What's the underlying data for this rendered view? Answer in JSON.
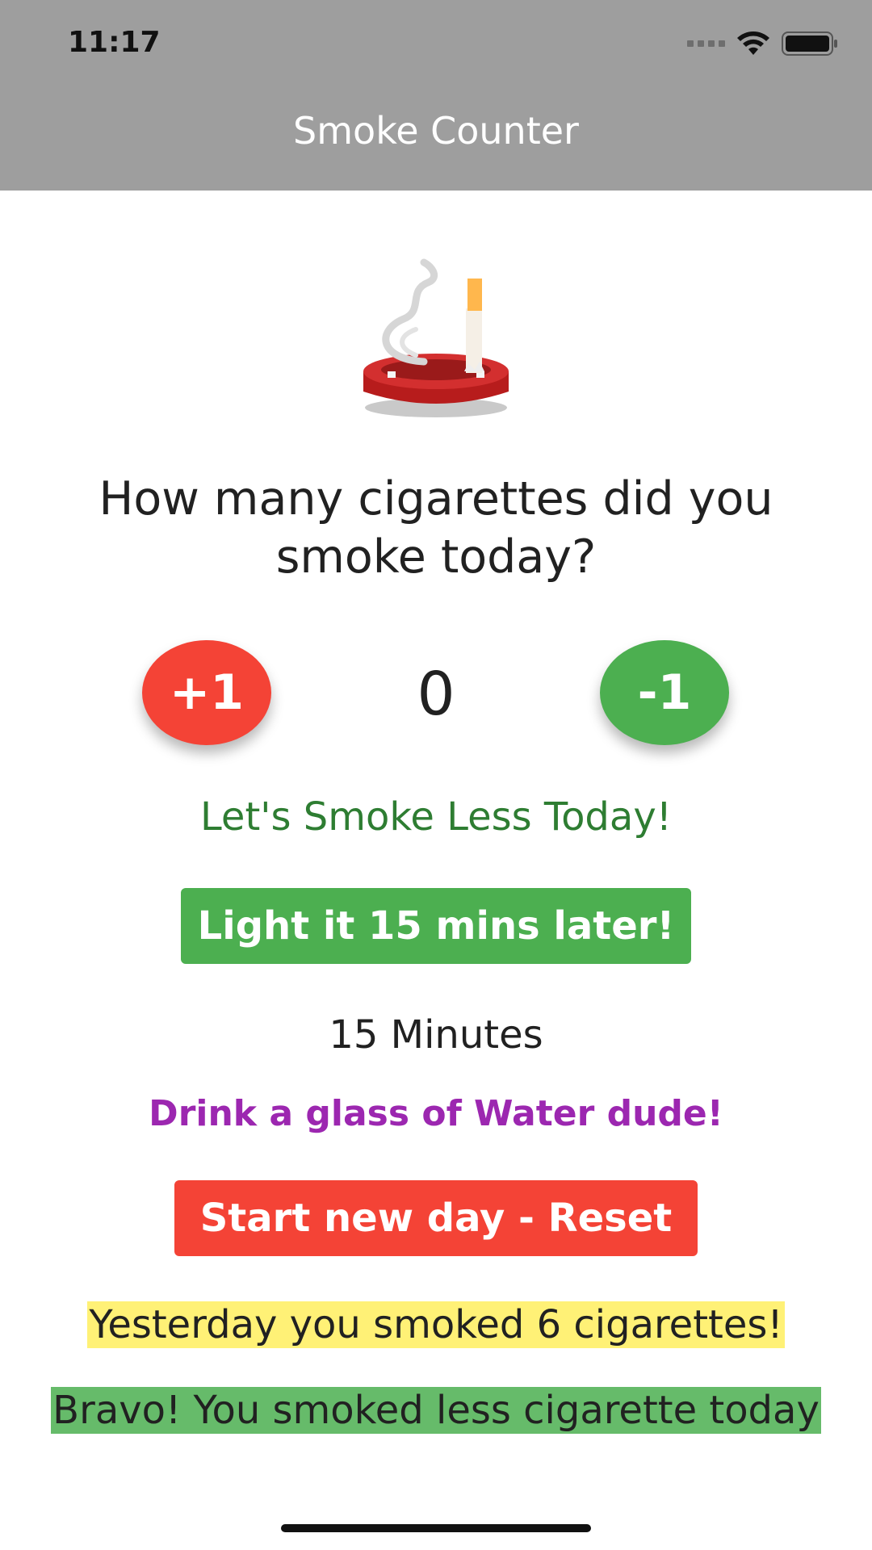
{
  "status_bar": {
    "time": "11:17",
    "icons": [
      "cellular-signal-icon",
      "wifi-icon",
      "battery-icon"
    ]
  },
  "header": {
    "title": "Smoke Counter",
    "background": "#9e9e9e"
  },
  "illustration": {
    "icon": "ashtray-cigarette-icon"
  },
  "question": "How many cigarettes did you smoke today?",
  "counter": {
    "increment_label": "+1",
    "value": "0",
    "decrement_label": "-1",
    "increment_color": "#f44336",
    "decrement_color": "#4caf50"
  },
  "motivation": "Let's Smoke Less Today!",
  "delay_button": {
    "label": "Light it 15 mins later!",
    "color": "#4caf50"
  },
  "timer": "15 Minutes",
  "tip": "Drink a glass of Water dude!",
  "reset_button": {
    "label": "Start new day - Reset",
    "color": "#f44336"
  },
  "yesterday_message": "Yesterday you smoked 6 cigarettes!",
  "comparison_message": "Bravo! You smoked less cigarette today",
  "colors": {
    "tip": "#9c27b0",
    "motivation": "#2e7d32",
    "yesterday_highlight": "#fff176",
    "comparison_highlight": "#66bb6a"
  }
}
